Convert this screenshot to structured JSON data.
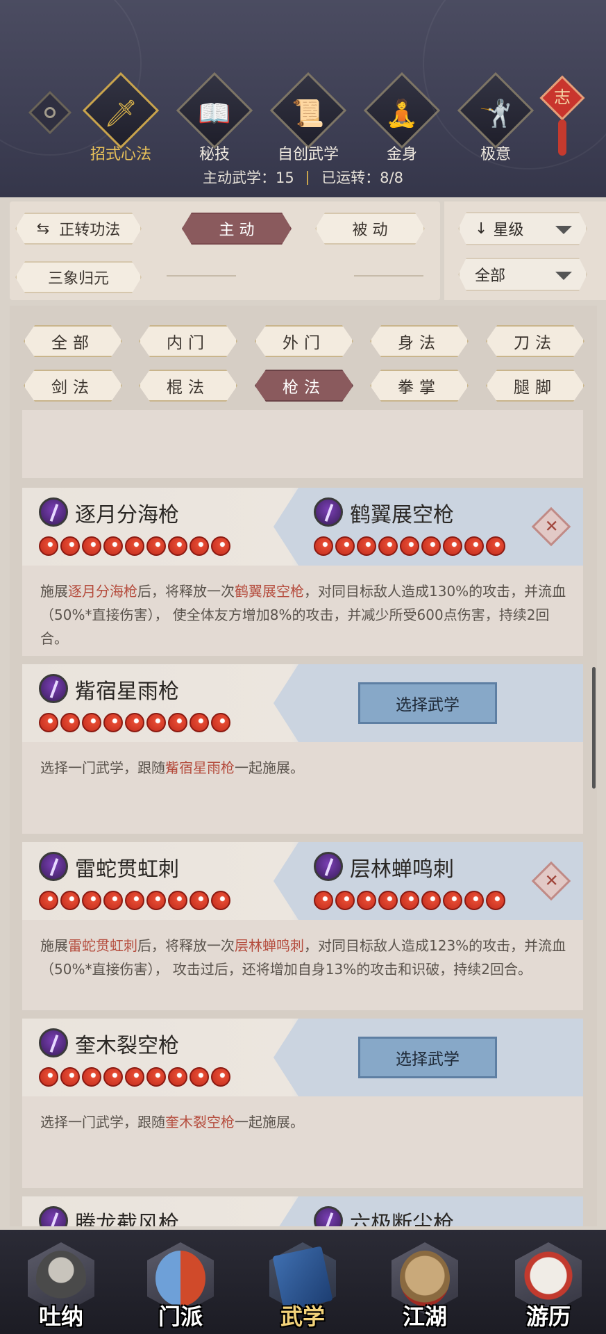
{
  "header": {
    "categories": [
      {
        "label": "招式心法",
        "icon": "sword-icon"
      },
      {
        "label": "秘技",
        "icon": "book-icon"
      },
      {
        "label": "自创武学",
        "icon": "scroll-icon"
      },
      {
        "label": "金身",
        "icon": "meditation-icon"
      },
      {
        "label": "极意",
        "icon": "martial-pose-icon"
      }
    ],
    "knot_char": "志",
    "active_label": "主动武学：",
    "active_count": "15",
    "running_label": "已运转：",
    "running_value": "8/8"
  },
  "controls": {
    "switch_label": "正转功法",
    "tab_active": "主 动",
    "tab_passive": "被 动",
    "sanxiang_label": "三象归元",
    "sort_label": "星级",
    "scope_label": "全部"
  },
  "filters": [
    "全部",
    "内门",
    "外门",
    "身法",
    "刀法",
    "剑法",
    "棍法",
    "枪法",
    "拳掌",
    "腿脚"
  ],
  "cards": [
    {
      "left": "逐月分海枪",
      "right": "鹤翼展空枪",
      "desc_parts": [
        "施展",
        "逐月分海枪",
        "后，将释放一次",
        "鹤翼展空枪",
        "，对同目标敌人造成130%的攻击，并流血（50%*直接伤害）， 使全体友方增加8%的攻击，并减少所受600点伤害，持续2回合。"
      ]
    },
    {
      "left": "觜宿星雨枪",
      "button": "选择武学",
      "desc_parts": [
        "选择一门武学，跟随",
        "觜宿星雨枪",
        "一起施展。"
      ]
    },
    {
      "left": "雷蛇贯虹刺",
      "right": "层林蝉鸣刺",
      "desc_parts": [
        "施展",
        "雷蛇贯虹刺",
        "后，将释放一次",
        "层林蝉鸣刺",
        "，对同目标敌人造成123%的攻击，并流血（50%*直接伤害）， 攻击过后，还将增加自身13%的攻击和识破，持续2回合。"
      ]
    },
    {
      "left": "奎木裂空枪",
      "button": "选择武学",
      "desc_parts": [
        "选择一门武学，跟随",
        "奎木裂空枪",
        "一起施展。"
      ]
    },
    {
      "left": "腾龙截风枪",
      "right": "六极断尘枪"
    }
  ],
  "remove_symbol": "✕",
  "bottom_nav": [
    {
      "label": "吐纳",
      "icon": "monk-icon"
    },
    {
      "label": "门派",
      "icon": "sect-banner-icon"
    },
    {
      "label": "武学",
      "icon": "manual-book-icon"
    },
    {
      "label": "江湖",
      "icon": "straw-hat-icon"
    },
    {
      "label": "游历",
      "icon": "horse-icon"
    }
  ],
  "colors": {
    "accent_gold": "#e8c15a",
    "active_tab": "#8a5a5d",
    "highlight_text": "#b54d3e",
    "select_button": "#87a8c8"
  }
}
